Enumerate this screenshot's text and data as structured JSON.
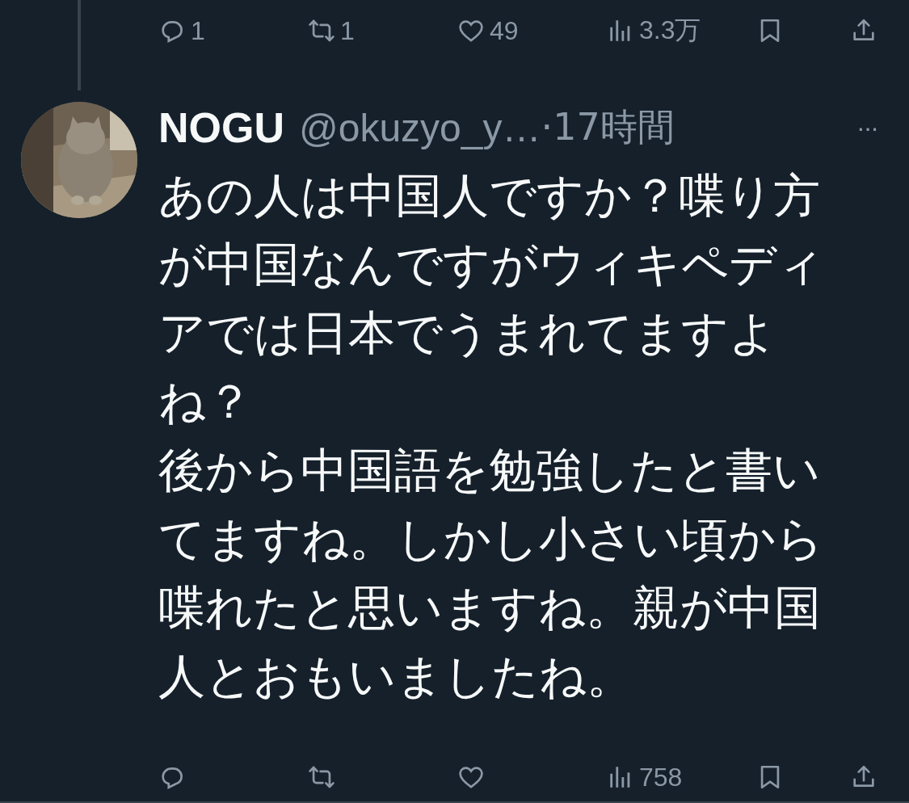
{
  "previous_tweet": {
    "actions": [
      {
        "kind": "reply",
        "count": "1"
      },
      {
        "kind": "retweet",
        "count": "1"
      },
      {
        "kind": "like",
        "count": "49"
      },
      {
        "kind": "views",
        "count": "3.3万"
      },
      {
        "kind": "bookmark"
      },
      {
        "kind": "share"
      }
    ]
  },
  "tweet": {
    "name": "NOGU",
    "handle": "@okuzyo_y…",
    "time": "·17時間",
    "more": "···",
    "paragraphs": [
      "あの人は中国人ですか？喋り方が中国なんですがウィキペディアでは日本でうまれてますよね？",
      "後から中国語を勉強したと書いてますね。しかし小さい頃から喋れたと思いますね。親が中国人とおもいましたね。"
    ],
    "actions": [
      {
        "kind": "reply"
      },
      {
        "kind": "retweet"
      },
      {
        "kind": "like"
      },
      {
        "kind": "views",
        "count": "758"
      },
      {
        "kind": "bookmark"
      },
      {
        "kind": "share"
      }
    ]
  }
}
